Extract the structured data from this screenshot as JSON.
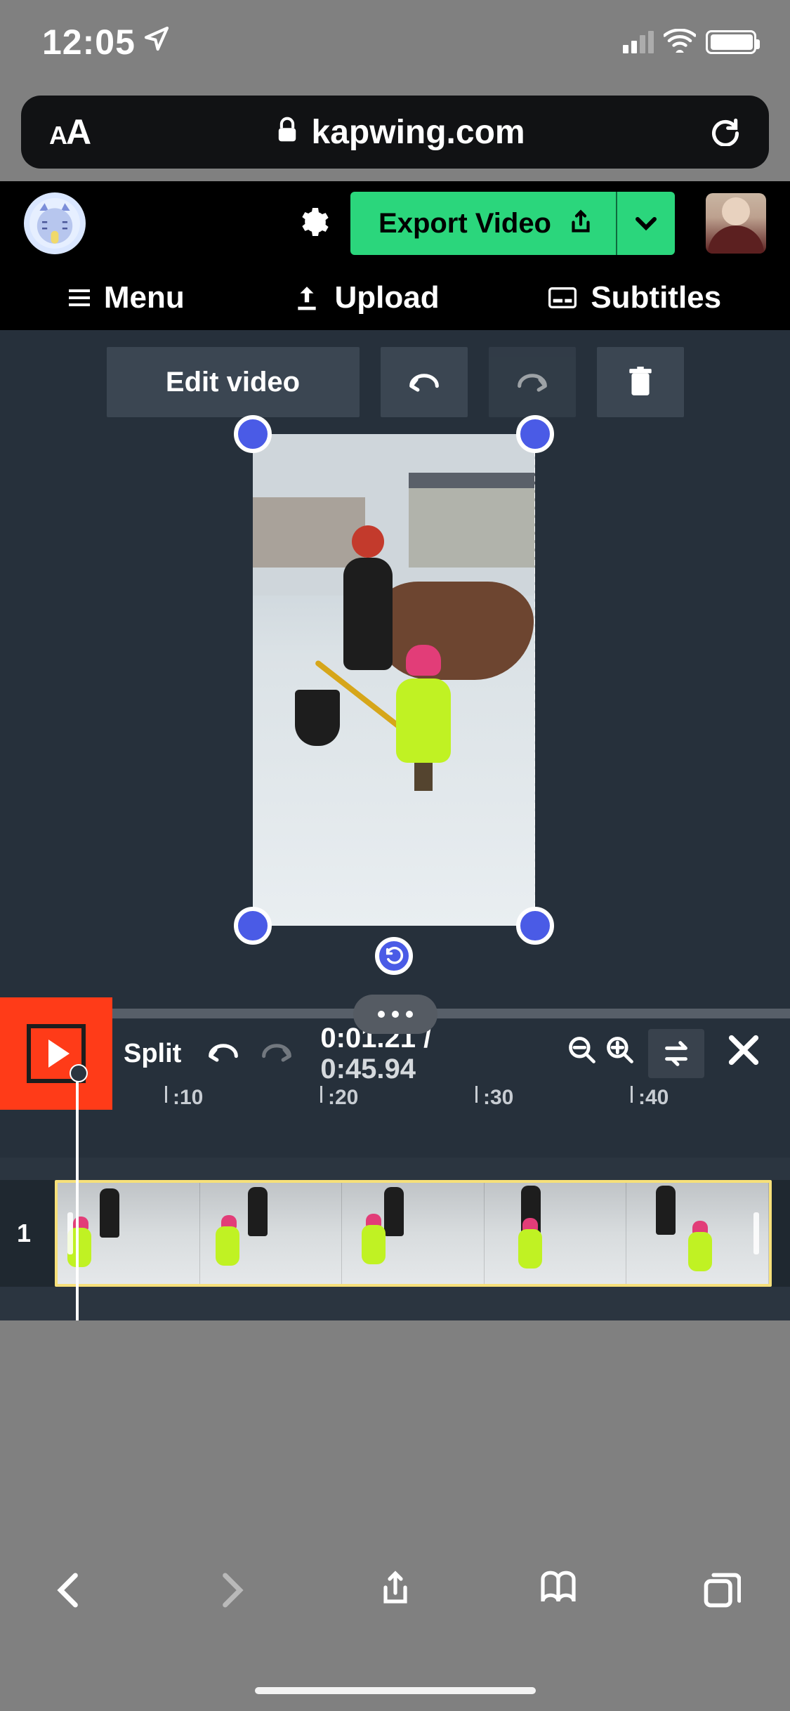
{
  "status": {
    "time": "12:05"
  },
  "browser": {
    "url_display": "kapwing.com"
  },
  "header": {
    "export_label": "Export Video"
  },
  "menubar": {
    "menu": "Menu",
    "upload": "Upload",
    "subtitles": "Subtitles"
  },
  "toolbar": {
    "edit_video": "Edit video"
  },
  "timeline_controls": {
    "split": "Split",
    "current_time": "0:01.21",
    "total_time": "0:45.94"
  },
  "ruler": {
    "ticks": [
      ":10",
      ":20",
      ":30",
      ":40"
    ]
  },
  "tracks": {
    "row1_label": "1"
  }
}
